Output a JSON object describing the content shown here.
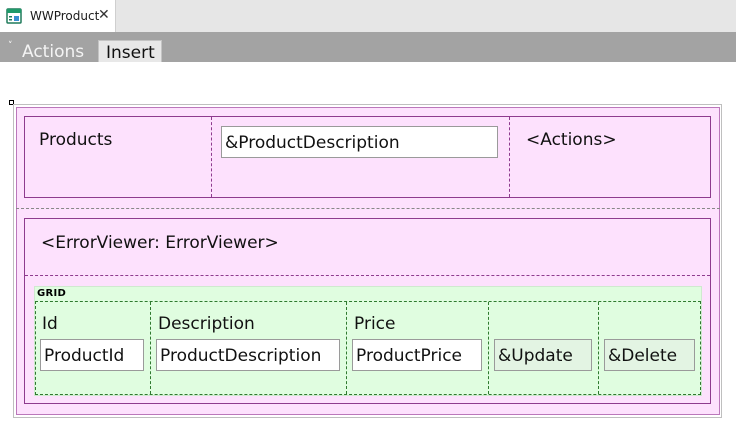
{
  "document_tab": {
    "title": "WWProduct",
    "close_glyph": "✕",
    "icon": "webpanel-icon"
  },
  "toolbar": {
    "actions_chevron": "˅",
    "actions_label": "Actions",
    "insert_label": "Insert"
  },
  "form": {
    "header": {
      "title": "Products",
      "filter_value": "&ProductDescription",
      "actions_placeholder": "<Actions>"
    },
    "error_viewer": "<ErrorViewer: ErrorViewer>",
    "grid": {
      "label": "GRID",
      "columns": [
        {
          "header": "Id",
          "value": "ProductId"
        },
        {
          "header": "Description",
          "value": "ProductDescription"
        },
        {
          "header": "Price",
          "value": "ProductPrice"
        }
      ],
      "actions": [
        {
          "value": "&Update"
        },
        {
          "value": "&Delete"
        }
      ]
    }
  },
  "colors": {
    "table_fill": "#fde1fd",
    "table_border": "#8e3b8e",
    "grid_fill": "#e0fde0",
    "grid_border": "#2f7a2f",
    "toolbar": "#a3a3a3",
    "tabstrip": "#e6e6e6"
  }
}
